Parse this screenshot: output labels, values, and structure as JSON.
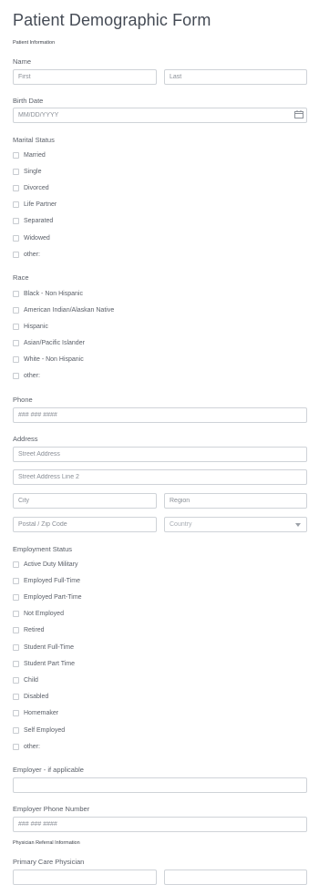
{
  "form": {
    "title": "Patient Demographic Form",
    "section_patient": "Patient Information",
    "name": {
      "label": "Name",
      "first_placeholder": "First",
      "last_placeholder": "Last"
    },
    "birth_date": {
      "label": "Birth Date",
      "placeholder": "MM/DD/YYYY",
      "icon": "calendar-icon"
    },
    "marital_status": {
      "label": "Marital Status",
      "options": [
        "Married",
        "Single",
        "Divorced",
        "Life Partner",
        "Separated",
        "Widowed",
        "other:"
      ]
    },
    "race": {
      "label": "Race",
      "options": [
        "Black - Non Hispanic",
        "American Indian/Alaskan Native",
        "Hispanic",
        "Asian/Pacific Islander",
        "White - Non Hispanic",
        "other:"
      ]
    },
    "phone": {
      "label": "Phone",
      "placeholder": "### ### ####"
    },
    "address": {
      "label": "Address",
      "street_placeholder": "Street Address",
      "street2_placeholder": "Street Address Line 2",
      "city_placeholder": "City",
      "region_placeholder": "Region",
      "postal_placeholder": "Postal / Zip Code",
      "country_value": "Country"
    },
    "employment_status": {
      "label": "Employment Status",
      "options": [
        "Active Duty Military",
        "Employed Full-Time",
        "Employed Part-Time",
        "Not Employed",
        "Retired",
        "Student Full-Time",
        "Student Part Time",
        "Child",
        "Disabled",
        "Homemaker",
        "Self Employed",
        "other:"
      ]
    },
    "employer": {
      "label": "Employer - if applicable",
      "value": ""
    },
    "employer_phone": {
      "label": "Employer Phone Number",
      "placeholder": "### ### ####"
    },
    "section_physician": "Physician Referral Information",
    "primary_care": {
      "label": "Primary Care Physician"
    }
  }
}
